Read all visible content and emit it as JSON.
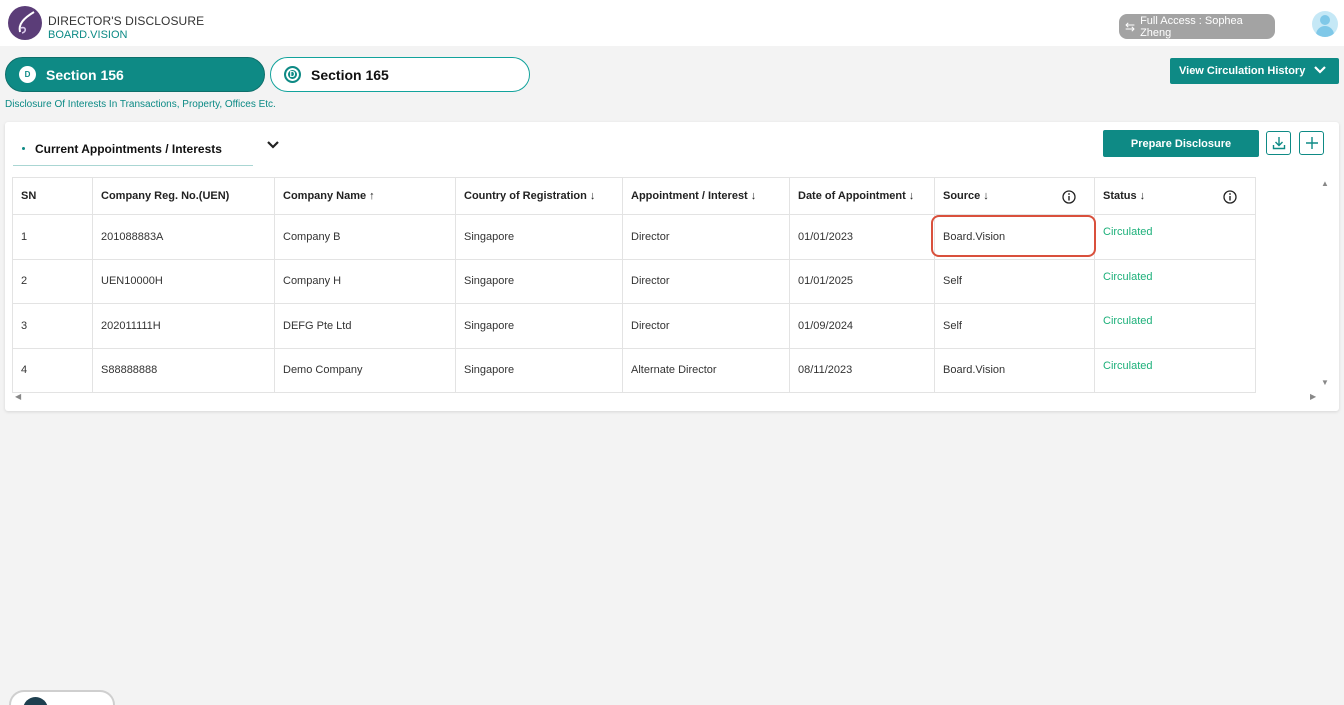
{
  "header": {
    "title": "DIRECTOR'S DISCLOSURE",
    "subtitle": "BOARD.VISION",
    "access_label": "Full Access : Sophea Zheng"
  },
  "sections": [
    {
      "badge": "D",
      "label": "Section 156",
      "active": true
    },
    {
      "badge": "D",
      "label": "Section 165",
      "active": false
    }
  ],
  "section_description": "Disclosure Of Interests In Transactions, Property, Offices Etc.",
  "history_button": "View Circulation History",
  "card": {
    "tab_label": "Current Appointments / Interests",
    "prepare_button": "Prepare Disclosure"
  },
  "table": {
    "columns": [
      "SN",
      "Company Reg. No.(UEN)",
      "Company Name",
      "Country of Registration",
      "Appointment / Interest",
      "Date of Appointment",
      "Source",
      "Status"
    ],
    "rows": [
      [
        "1",
        "201088883A",
        "Company B",
        "Singapore",
        "Director",
        "01/01/2023",
        "Board.Vision",
        "Circulated"
      ],
      [
        "2",
        "UEN10000H",
        "Company H",
        "Singapore",
        "Director",
        "01/01/2025",
        "Self",
        "Circulated"
      ],
      [
        "3",
        "202011111H",
        "DEFG Pte Ltd",
        "Singapore",
        "Director",
        "01/09/2024",
        "Self",
        "Circulated"
      ],
      [
        "4",
        "S88888888",
        "Demo Company",
        "Singapore",
        "Alternate Director",
        "08/11/2023",
        "Board.Vision",
        "Circulated"
      ]
    ]
  },
  "colors": {
    "teal": "#0e8a85",
    "status_green": "#1db07a",
    "highlight_red": "#d9503c"
  }
}
